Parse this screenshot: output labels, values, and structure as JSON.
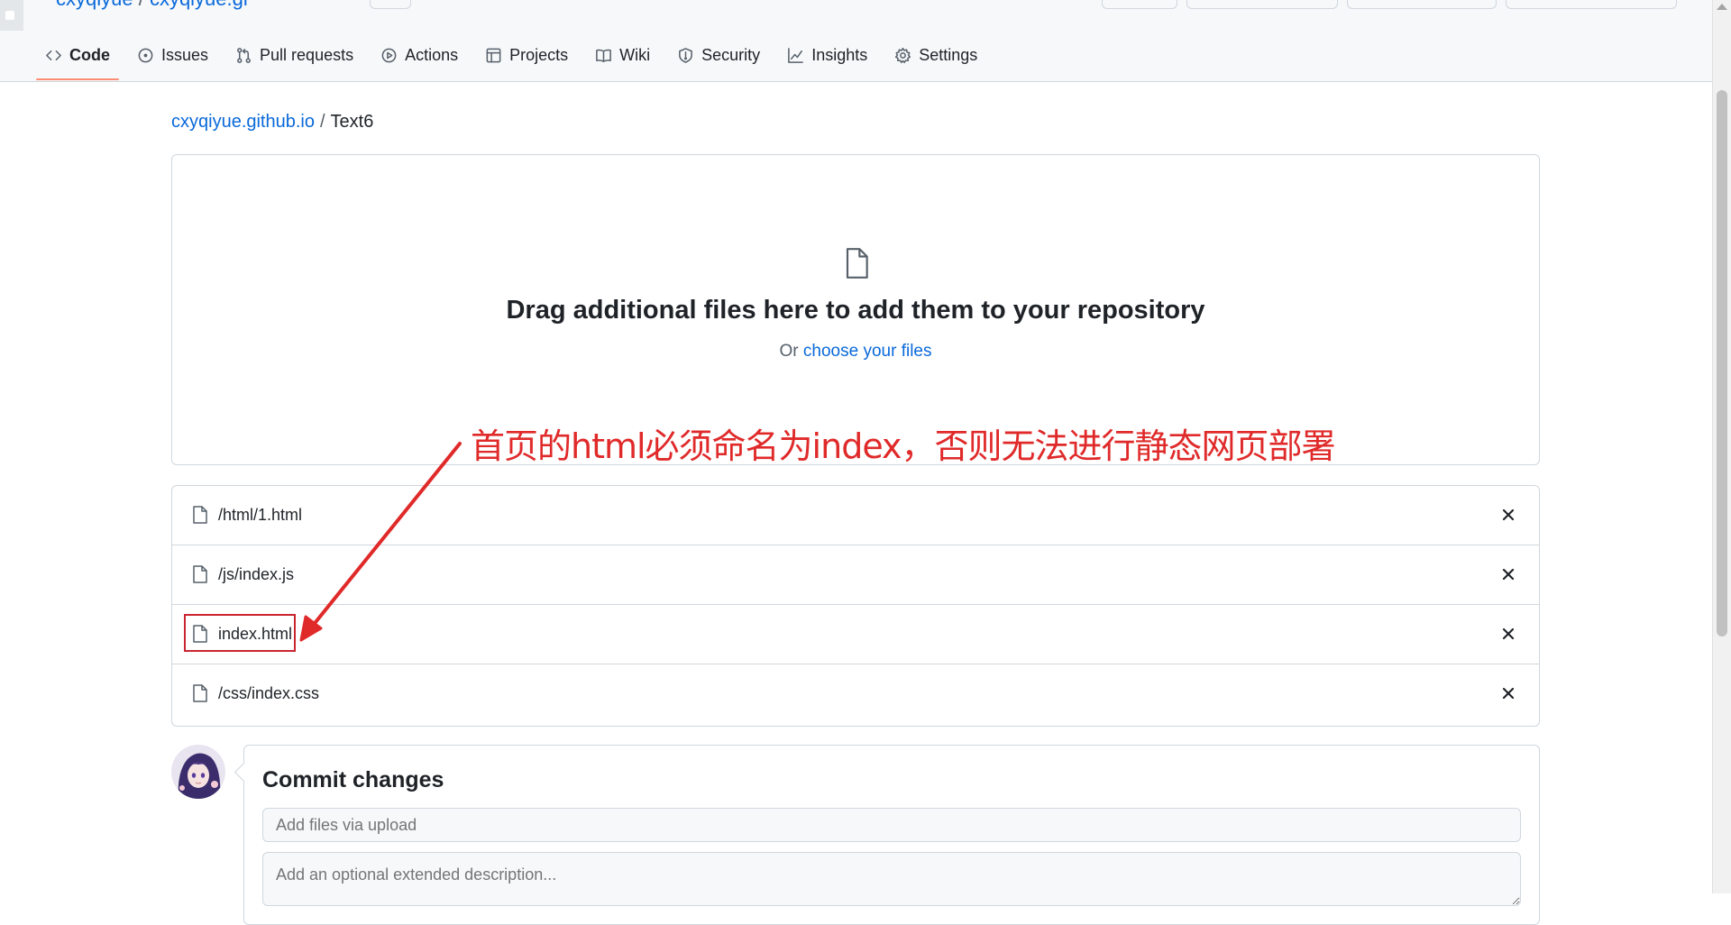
{
  "header": {
    "repo_title_partial_owner": "cxyqiyue",
    "repo_title_partial_sep": " / ",
    "repo_title_partial_name": "cxyqiyue.gi"
  },
  "tabs": [
    {
      "label": "Code",
      "icon": "code-icon",
      "active": true
    },
    {
      "label": "Issues",
      "icon": "issue-opened-icon"
    },
    {
      "label": "Pull requests",
      "icon": "git-pull-request-icon"
    },
    {
      "label": "Actions",
      "icon": "play-icon"
    },
    {
      "label": "Projects",
      "icon": "table-icon"
    },
    {
      "label": "Wiki",
      "icon": "book-icon"
    },
    {
      "label": "Security",
      "icon": "shield-icon"
    },
    {
      "label": "Insights",
      "icon": "graph-icon"
    },
    {
      "label": "Settings",
      "icon": "gear-icon"
    }
  ],
  "breadcrumb": {
    "repo": "cxyqiyue.github.io",
    "separator": "/",
    "folder": "Text6"
  },
  "dropzone": {
    "title": "Drag additional files here to add them to your repository",
    "or_text": "Or ",
    "choose_link": "choose your files",
    "icon": "file-icon"
  },
  "annotation": {
    "text": "首页的html必须命名为index，否则无法进行静态网页部署",
    "color": "#e02a2a"
  },
  "files": [
    {
      "name": "/html/1.html"
    },
    {
      "name": "/js/index.js"
    },
    {
      "name": "index.html",
      "highlighted": true
    },
    {
      "name": "/css/index.css"
    }
  ],
  "commit": {
    "title": "Commit changes",
    "summary_placeholder": "Add files via upload",
    "description_placeholder": "Add an optional extended description..."
  },
  "colors": {
    "link": "#0969da",
    "active_tab_underline": "#fd8c73",
    "annotation_red": "#e02a2a"
  }
}
